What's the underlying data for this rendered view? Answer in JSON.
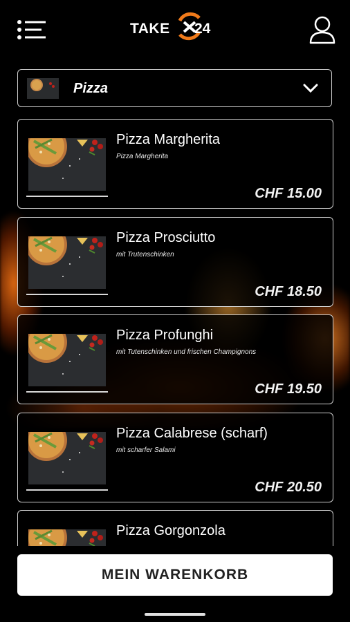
{
  "header": {
    "logo_text": "TAKE",
    "logo_number": "24",
    "menu_icon": "hamburger-list-icon",
    "user_icon": "user-profile-icon"
  },
  "category": {
    "label": "Pizza",
    "icon": "chevron-down-icon"
  },
  "products": [
    {
      "name": "Pizza Margherita",
      "description": "Pizza Margherita",
      "price": "CHF 15.00"
    },
    {
      "name": "Pizza Prosciutto",
      "description": "mit Trutenschinken",
      "price": "CHF 18.50"
    },
    {
      "name": "Pizza Profunghi",
      "description": "mit Tutenschinken und frischen Champignons",
      "price": "CHF 19.50"
    },
    {
      "name": "Pizza Calabrese (scharf)",
      "description": "mit scharfer Salami",
      "price": "CHF 20.50"
    },
    {
      "name": "Pizza Gorgonzola",
      "description": "",
      "price": ""
    }
  ],
  "cart_button": "MEIN WARENKORB",
  "colors": {
    "background": "#000000",
    "logo_accent": "#f07a1a",
    "card_border": "#d0d0d0",
    "button_bg": "#ffffff"
  }
}
